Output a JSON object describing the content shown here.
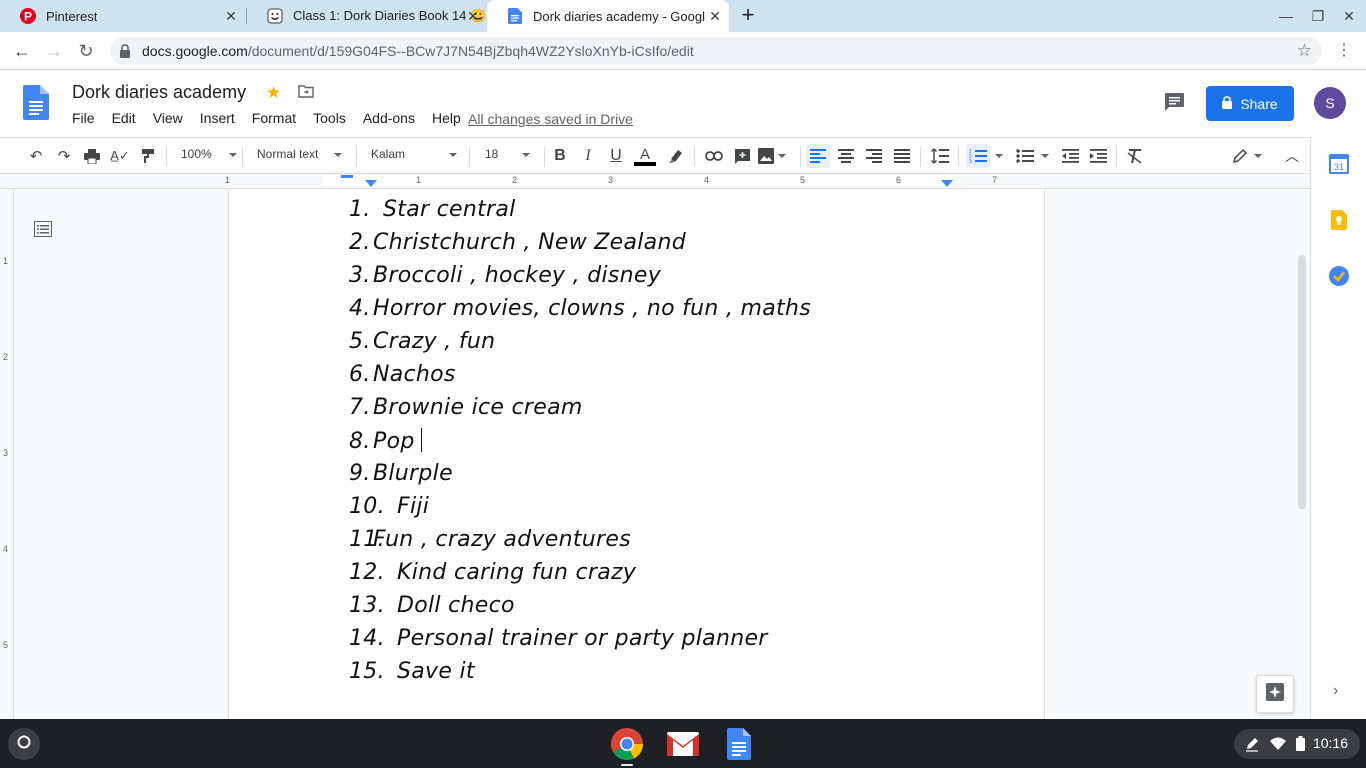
{
  "browser": {
    "tabs": [
      {
        "title": "Pinterest",
        "favicon": "pinterest-icon",
        "active": false
      },
      {
        "title": "Class 1: Dork Diaries Book 14 😀",
        "favicon": "smiley-icon",
        "active": false
      },
      {
        "title": "Dork diaries academy - Google D",
        "favicon": "docs-icon",
        "active": true
      }
    ],
    "url_host": "docs.google.com",
    "url_path": "/document/d/159G04FS--BCw7J7N54BjZbqh4WZ2YsloXnYb-iCsIfo/edit"
  },
  "docs": {
    "title": "Dork diaries academy",
    "menu": [
      "File",
      "Edit",
      "View",
      "Insert",
      "Format",
      "Tools",
      "Add-ons",
      "Help"
    ],
    "saved_status": "All changes saved in Drive",
    "share_label": "Share",
    "avatar_initial": "S",
    "toolbar": {
      "zoom": "100%",
      "style": "Normal text",
      "font": "Kalam",
      "size": "18"
    }
  },
  "ruler": {
    "h_numbers": [
      "1",
      "1",
      "2",
      "3",
      "4",
      "5",
      "6",
      "7"
    ],
    "v_numbers": [
      "1",
      "2",
      "3",
      "4",
      "5"
    ]
  },
  "list_items": [
    {
      "num": "1.",
      "text": "Star central"
    },
    {
      "num": "2.",
      "text": "Christchurch , New Zealand"
    },
    {
      "num": "3.",
      "text": "Broccoli , hockey , disney"
    },
    {
      "num": "4.",
      "text": "Horror movies, clowns , no fun , maths"
    },
    {
      "num": "5.",
      "text": "Crazy , fun"
    },
    {
      "num": "6.",
      "text": "Nachos"
    },
    {
      "num": "7.",
      "text": "Brownie ice cream"
    },
    {
      "num": "8.",
      "text": "Pop"
    },
    {
      "num": "9.",
      "text": "Blurple"
    },
    {
      "num": "10.",
      "text": "Fiji"
    },
    {
      "num": "11.",
      "text": "Fun , crazy adventures"
    },
    {
      "num": "12.",
      "text": "Kind caring fun crazy"
    },
    {
      "num": "13.",
      "text": "Doll checo"
    },
    {
      "num": "14.",
      "text": "Personal trainer or party planner"
    },
    {
      "num": "15.",
      "text": "Save it"
    }
  ],
  "shelf": {
    "apps": [
      "chrome-icon",
      "gmail-icon",
      "docs-icon"
    ],
    "time": "10:16"
  }
}
